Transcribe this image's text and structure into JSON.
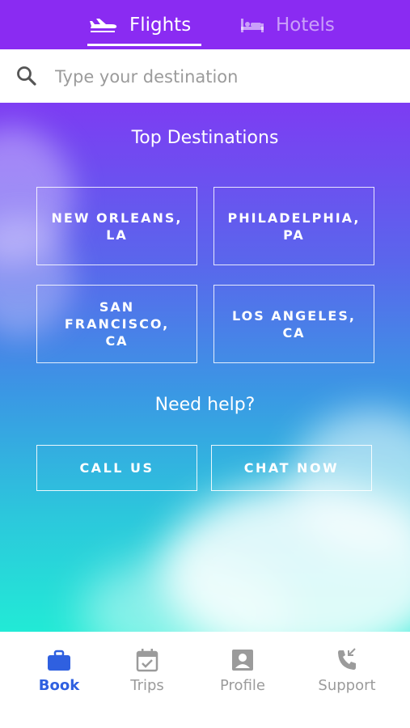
{
  "tabs": [
    {
      "label": "Flights",
      "icon": "plane-icon",
      "active": true
    },
    {
      "label": "Hotels",
      "icon": "bed-icon",
      "active": false
    }
  ],
  "search": {
    "placeholder": "Type your destination",
    "value": ""
  },
  "top_destinations": {
    "title": "Top Destinations",
    "items": [
      {
        "label": "NEW ORLEANS, LA"
      },
      {
        "label": "PHILADELPHIA, PA"
      },
      {
        "label": "SAN FRANCISCO, CA"
      },
      {
        "label": "LOS ANGELES, CA"
      }
    ]
  },
  "help": {
    "title": "Need help?",
    "call_label": "CALL US",
    "chat_label": "CHAT NOW"
  },
  "bottom_nav": [
    {
      "label": "Book",
      "icon": "briefcase-icon",
      "active": true
    },
    {
      "label": "Trips",
      "icon": "calendar-icon",
      "active": false
    },
    {
      "label": "Profile",
      "icon": "profile-icon",
      "active": false
    },
    {
      "label": "Support",
      "icon": "phone-icon",
      "active": false
    }
  ],
  "colors": {
    "header": "#8a2bf2",
    "active_nav": "#2f60e0",
    "inactive_nav": "#9b9b9b",
    "gradient_top": "#7d3cf3",
    "gradient_bottom": "#22ead6"
  }
}
